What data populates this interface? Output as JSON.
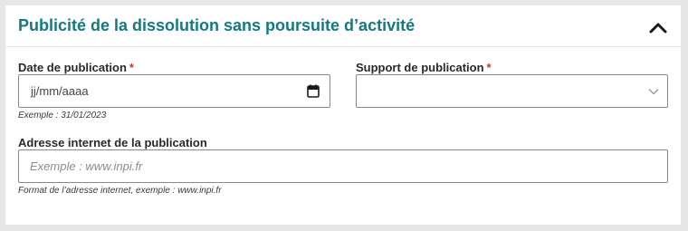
{
  "section": {
    "title": "Publicité de la dissolution sans poursuite d’activité",
    "collapse_icon": "chevron-up-icon"
  },
  "fields": {
    "date": {
      "label": "Date de publication",
      "required_mark": "*",
      "value_placeholder": "jj/mm/aaaa",
      "hint": "Exemple : 31/01/2023",
      "icon": "calendar-icon"
    },
    "support": {
      "label": "Support de publication",
      "required_mark": "*",
      "value": "",
      "icon": "chevron-down-icon"
    },
    "url": {
      "label": "Adresse internet de la publication",
      "placeholder": "Exemple : www.inpi.fr",
      "value": "",
      "hint": "Format de l’adresse internet, exemple : www.inpi.fr"
    }
  },
  "colors": {
    "title": "#117a85",
    "required": "#d0342c",
    "background": "#e6e6e6",
    "border": "#8a8a8a"
  }
}
